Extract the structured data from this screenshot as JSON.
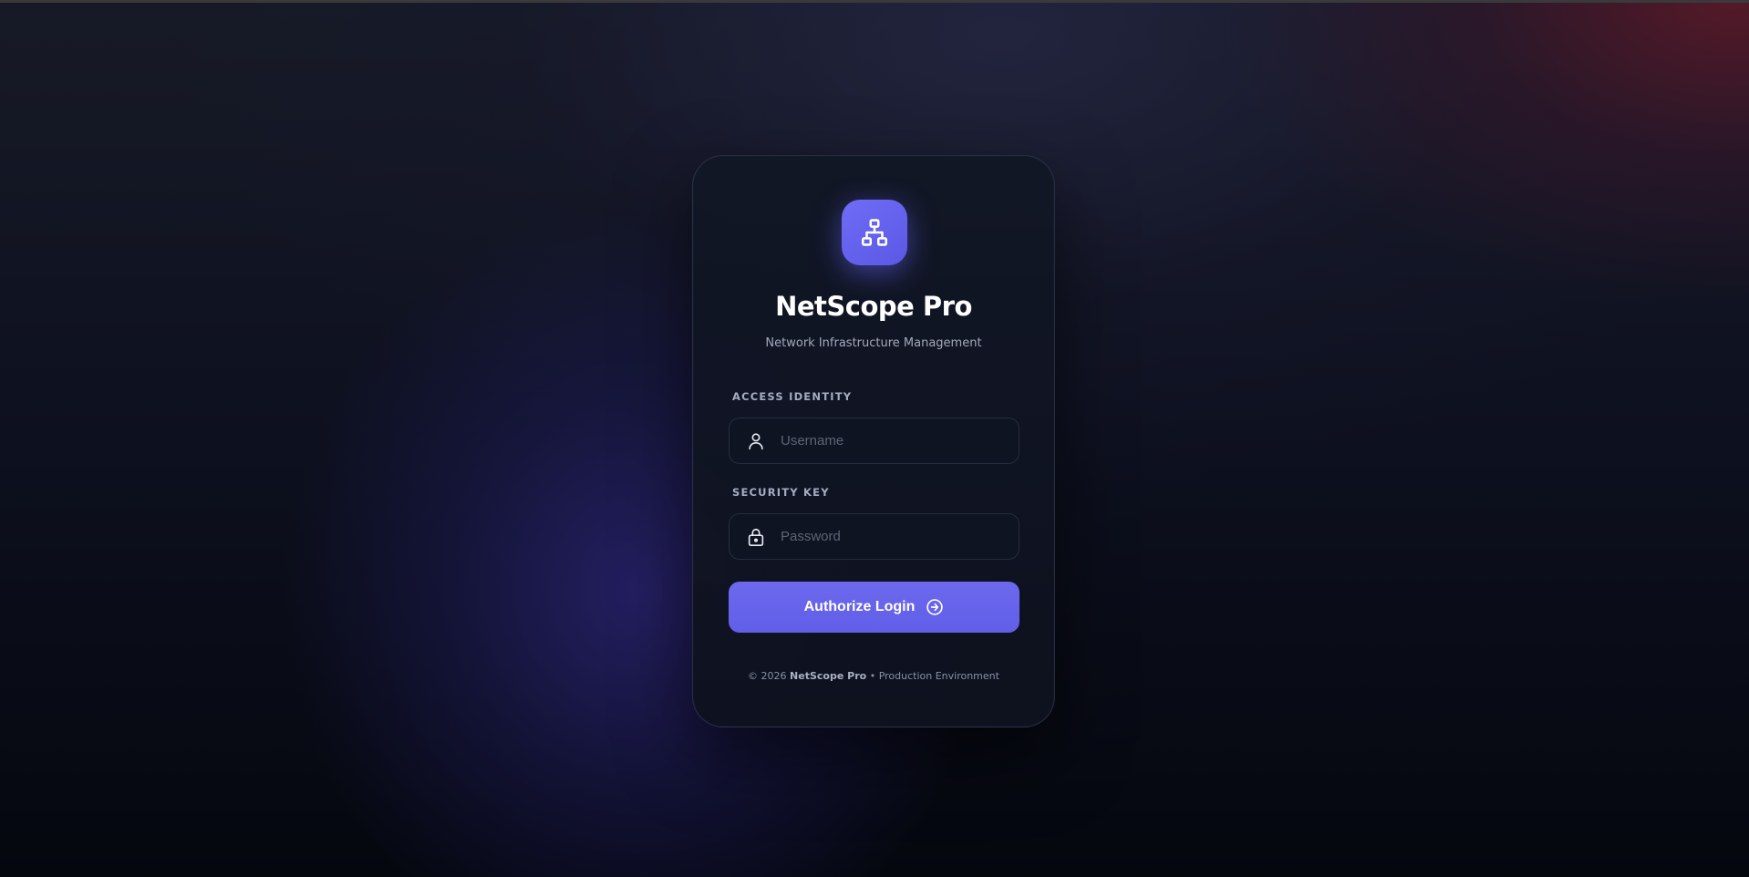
{
  "app": {
    "title": "NetScope Pro",
    "subtitle": "Network Infrastructure Management",
    "logo_icon": "network-hierarchy-icon"
  },
  "form": {
    "username": {
      "label": "ACCESS IDENTITY",
      "placeholder": "Username",
      "value": "",
      "icon": "user-icon"
    },
    "password": {
      "label": "SECURITY KEY",
      "placeholder": "Password",
      "value": "",
      "icon": "lock-icon"
    },
    "submit": {
      "label": "Authorize Login",
      "icon": "arrow-right-circle-icon"
    }
  },
  "footer": {
    "copyright": "© 2026",
    "brand": "NetScope Pro",
    "separator": "•",
    "environment": "Production Environment"
  },
  "colors": {
    "accent": "#6360EC",
    "background": "#080B16",
    "card": "#121726"
  }
}
